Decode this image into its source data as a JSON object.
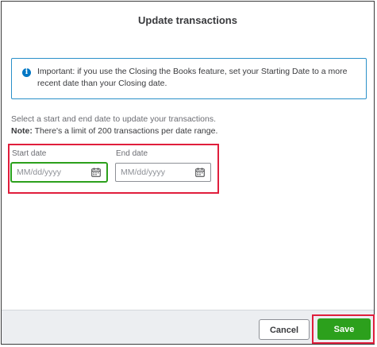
{
  "dialog": {
    "title": "Update transactions"
  },
  "info": {
    "icon": "info-icon",
    "text": "Important: if you use the Closing the Books feature, set your Starting Date to a more recent date than your Closing date."
  },
  "instructions": {
    "line1": "Select a start and end date to update your transactions.",
    "note_label": "Note:",
    "note_text": " There's a limit of 200 transactions per date range."
  },
  "start_date": {
    "label": "Start date",
    "placeholder": "MM/dd/yyyy",
    "value": "",
    "icon": "calendar-icon"
  },
  "end_date": {
    "label": "End date",
    "placeholder": "MM/dd/yyyy",
    "value": "",
    "icon": "calendar-icon"
  },
  "footer": {
    "cancel_label": "Cancel",
    "save_label": "Save"
  },
  "colors": {
    "accent": "#2ca01c",
    "highlight": "#e01e3c",
    "info_border": "#2a90c9",
    "info_icon": "#0077c5"
  }
}
